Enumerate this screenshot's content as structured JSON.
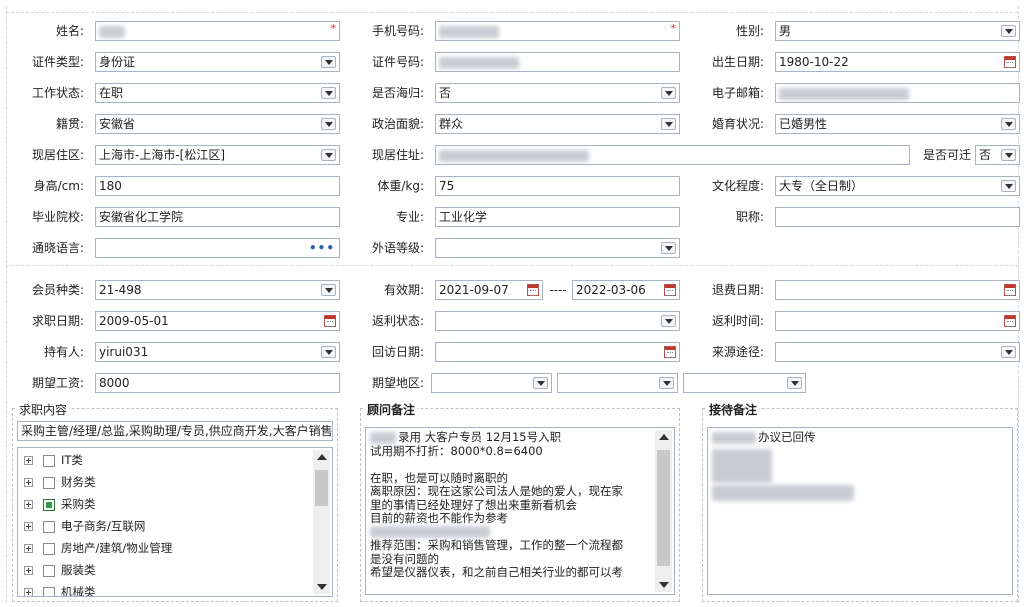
{
  "form": {
    "name": {
      "label": "姓名:",
      "value": ""
    },
    "mobile": {
      "label": "手机号码:",
      "value": ""
    },
    "gender": {
      "label": "性别:",
      "value": "男"
    },
    "id_type": {
      "label": "证件类型:",
      "value": "身份证"
    },
    "id_number": {
      "label": "证件号码:",
      "value": ""
    },
    "birth_date": {
      "label": "出生日期:",
      "value": "1980-10-22"
    },
    "work_status": {
      "label": "工作状态:",
      "value": "在职"
    },
    "overseas_returnee": {
      "label": "是否海归:",
      "value": "否"
    },
    "email": {
      "label": "电子邮箱:",
      "value": ""
    },
    "native_place": {
      "label": "籍贯:",
      "value": "安徽省"
    },
    "political_status": {
      "label": "政治面貌:",
      "value": "群众"
    },
    "marital_status": {
      "label": "婚育状况:",
      "value": "已婚男性"
    },
    "current_area": {
      "label": "现居住区:",
      "value": "上海市-上海市-[松江区]"
    },
    "current_address": {
      "label": "现居住址:",
      "value": ""
    },
    "relocatable": {
      "label": "是否可迁",
      "value": "否"
    },
    "height": {
      "label": "身高/cm:",
      "value": "180"
    },
    "weight": {
      "label": "体重/kg:",
      "value": "75"
    },
    "education": {
      "label": "文化程度:",
      "value": "大专（全日制）"
    },
    "school": {
      "label": "毕业院校:",
      "value": "安徽省化工学院"
    },
    "major": {
      "label": "专业:",
      "value": "工业化学"
    },
    "title": {
      "label": "职称:",
      "value": ""
    },
    "languages": {
      "label": "通晓语言:",
      "value": ""
    },
    "foreign_level": {
      "label": "外语等级:",
      "value": ""
    },
    "member_type": {
      "label": "会员种类:",
      "value": "21-498"
    },
    "valid_period": {
      "label": "有效期:",
      "from": "2021-09-07",
      "separator": "----",
      "to": "2022-03-06"
    },
    "refund_date": {
      "label": "退费日期:",
      "value": ""
    },
    "job_seek_date": {
      "label": "求职日期:",
      "value": "2009-05-01"
    },
    "rebate_status": {
      "label": "返利状态:",
      "value": ""
    },
    "rebate_time": {
      "label": "返利时间:",
      "value": ""
    },
    "holder": {
      "label": "持有人:",
      "value": "yirui031"
    },
    "revisit_date": {
      "label": "回访日期:",
      "value": ""
    },
    "source": {
      "label": "来源途径:",
      "value": ""
    },
    "expected_salary": {
      "label": "期望工资:",
      "value": "8000"
    },
    "expected_area": {
      "label": "期望地区:",
      "values": [
        "",
        "",
        ""
      ]
    }
  },
  "job_content": {
    "title": "求职内容",
    "summary": "采购主管/经理/总监,采购助理/专员,供应商开发,大客户销售",
    "categories": [
      {
        "label": "IT类",
        "checked": false
      },
      {
        "label": "财务类",
        "checked": false
      },
      {
        "label": "采购类",
        "checked": true
      },
      {
        "label": "电子商务/互联网",
        "checked": false
      },
      {
        "label": "房地产/建筑/物业管理",
        "checked": false
      },
      {
        "label": "服装类",
        "checked": false
      },
      {
        "label": "机械类",
        "checked": false
      }
    ]
  },
  "consultant_notes": {
    "title": "顾问备注",
    "lines": [
      "录用 大客户专员  12月15号入职",
      "试用期不打折：8000*0.8=6400",
      "",
      "在职，也是可以随时离职的",
      "离职原因：现在这家公司法人是她的爱人，现在家",
      "里的事情已经处理好了想出来重新看机会",
      "目前的薪资也不能作为参考",
      "",
      "推荐范围：采购和销售管理，工作的整一个流程都",
      "是没有问题的",
      "希望是仪器仪表，和之前自己相关行业的都可以考"
    ]
  },
  "reception_notes": {
    "title": "接待备注",
    "lines": [
      "办议已回传"
    ]
  }
}
